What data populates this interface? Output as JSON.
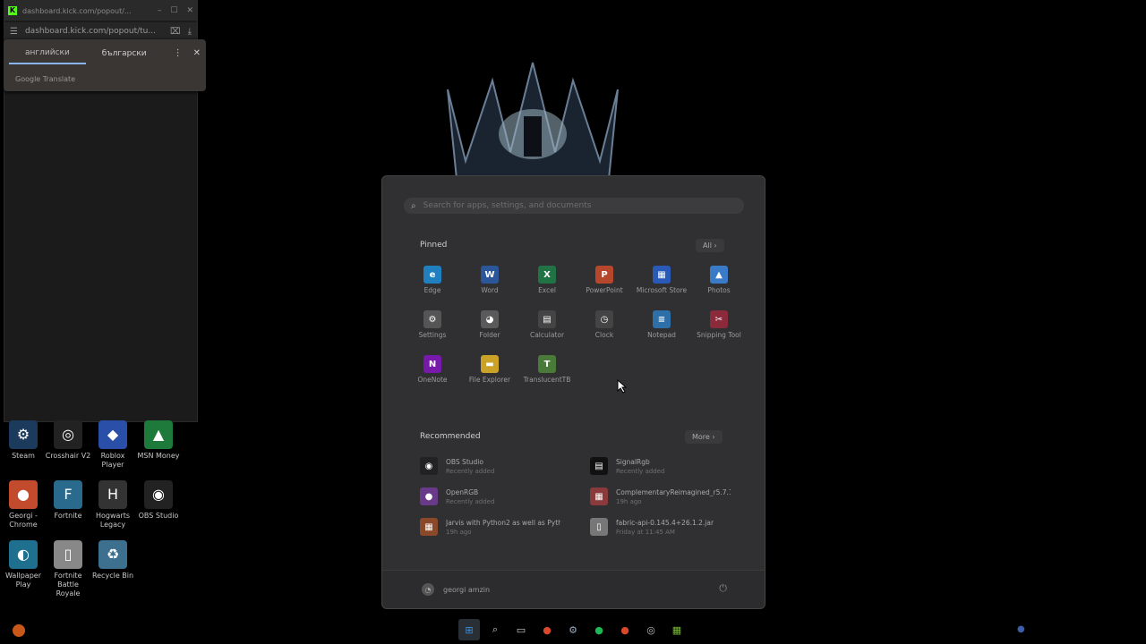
{
  "browser": {
    "favicon": "K",
    "title": "dashboard.kick.com/popout/...",
    "url": "dashboard.kick.com/popout/tu...",
    "icons": [
      "tune-icon",
      "translate-icon",
      "download-icon"
    ],
    "controls": [
      "minimize-icon",
      "maximize-icon",
      "close-icon"
    ]
  },
  "translate": {
    "tab_source": "английски",
    "tab_target": "български",
    "footer": "Google Translate"
  },
  "desktop": {
    "icons": [
      {
        "label": "Steam",
        "color": "#1b3a5c",
        "glyph": "⚙"
      },
      {
        "label": "Crosshair V2",
        "color": "#222",
        "glyph": "◎"
      },
      {
        "label": "Roblox Player",
        "color": "#2a4fa8",
        "glyph": "◆"
      },
      {
        "label": "MSN Money",
        "color": "#1d7a3a",
        "glyph": "▲"
      },
      {
        "label": "Georgi - Chrome",
        "color": "#c24a2d",
        "glyph": "●"
      },
      {
        "label": "Fortnite",
        "color": "#2a6a8c",
        "glyph": "F"
      },
      {
        "label": "Hogwarts Legacy",
        "color": "#333",
        "glyph": "H"
      },
      {
        "label": "OBS Studio",
        "color": "#222",
        "glyph": "◉"
      },
      {
        "label": "Wallpaper Play",
        "color": "#1f6f8f",
        "glyph": "◐"
      },
      {
        "label": "Fortnite Battle Royale",
        "color": "#888",
        "glyph": "▯"
      },
      {
        "label": "Recycle Bin",
        "color": "#3d6f8f",
        "glyph": "♻"
      }
    ]
  },
  "start": {
    "search_placeholder": "Search for apps, settings, and documents",
    "pinned_title": "Pinned",
    "all_label": "All",
    "pinned": [
      {
        "label": "Edge",
        "color": "#1f7fbf",
        "glyph": "e"
      },
      {
        "label": "Word",
        "color": "#2b579a",
        "glyph": "W"
      },
      {
        "label": "Excel",
        "color": "#217346",
        "glyph": "X"
      },
      {
        "label": "PowerPoint",
        "color": "#b7472a",
        "glyph": "P"
      },
      {
        "label": "Microsoft Store",
        "color": "#2a5ab8",
        "glyph": "▦"
      },
      {
        "label": "Photos",
        "color": "#3a7bc8",
        "glyph": "▲"
      },
      {
        "label": "Settings",
        "color": "#555",
        "glyph": "⚙"
      },
      {
        "label": "Folder",
        "color": "#5a5a5a",
        "glyph": "◕"
      },
      {
        "label": "Calculator",
        "color": "#444",
        "glyph": "▤"
      },
      {
        "label": "Clock",
        "color": "#444",
        "glyph": "◷"
      },
      {
        "label": "Notepad",
        "color": "#2f6fa8",
        "glyph": "≡"
      },
      {
        "label": "Snipping Tool",
        "color": "#8a2a3a",
        "glyph": "✂"
      },
      {
        "label": "OneNote",
        "color": "#7719aa",
        "glyph": "N"
      },
      {
        "label": "File Explorer",
        "color": "#c9a227",
        "glyph": "▬"
      },
      {
        "label": "TranslucentTB",
        "color": "#4a7a3a",
        "glyph": "T"
      }
    ],
    "recommended_title": "Recommended",
    "more_label": "More",
    "recommended": [
      {
        "name": "OBS Studio",
        "sub": "Recently added",
        "color": "#222",
        "glyph": "◉"
      },
      {
        "name": "SignalRgb",
        "sub": "Recently added",
        "color": "#111",
        "glyph": "▤"
      },
      {
        "name": "OpenRGB",
        "sub": "Recently added",
        "color": "#6a3a8a",
        "glyph": "●"
      },
      {
        "name": "ComplementaryReimagined_r5.7.1...",
        "sub": "19h ago",
        "color": "#8a3a3a",
        "glyph": "▦"
      },
      {
        "name": "Jarvis with Python2 as well as Pyth...",
        "sub": "19h ago",
        "color": "#8a4a2a",
        "glyph": "▦"
      },
      {
        "name": "fabric-api-0.145.4+26.1.2.jar",
        "sub": "Friday at 11:45 AM",
        "color": "#777",
        "glyph": "▯"
      }
    ],
    "user_name": "georgi amzin"
  },
  "taskbar": {
    "icons": [
      {
        "name": "start-icon",
        "glyph": "⊞",
        "color": "#3a8fd8"
      },
      {
        "name": "search-icon",
        "glyph": "⌕",
        "color": "#ccc"
      },
      {
        "name": "task-view-icon",
        "glyph": "▭",
        "color": "#ccc"
      },
      {
        "name": "chrome-icon",
        "glyph": "●",
        "color": "#d9482b"
      },
      {
        "name": "steam-icon",
        "glyph": "⚙",
        "color": "#9ab"
      },
      {
        "name": "spotify-icon",
        "glyph": "●",
        "color": "#1db954"
      },
      {
        "name": "chrome-profile-icon",
        "glyph": "●",
        "color": "#d9482b"
      },
      {
        "name": "crosshair-icon",
        "glyph": "◎",
        "color": "#bbb"
      },
      {
        "name": "minecraft-icon",
        "glyph": "▦",
        "color": "#7ab83a"
      }
    ]
  }
}
